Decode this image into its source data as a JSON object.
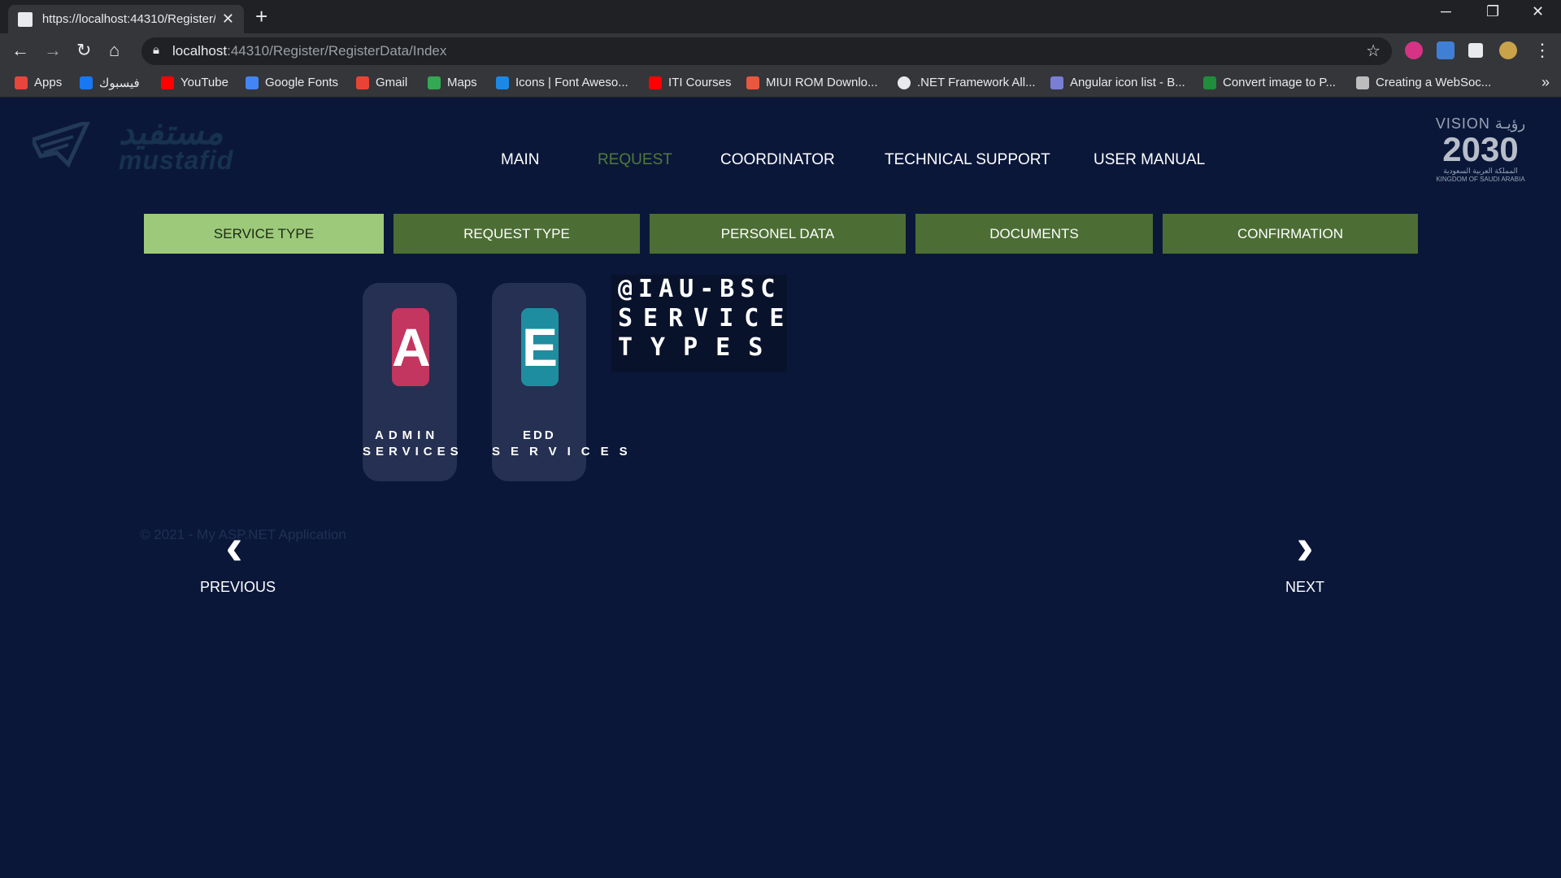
{
  "browser": {
    "tab_title": "https://localhost:44310/Register/",
    "tab_close": "✕",
    "new_tab": "+",
    "window_controls": [
      "─",
      "❐",
      "✕"
    ],
    "url_host": "localhost",
    "url_path": ":44310/Register/RegisterData/Index",
    "bookmarks": [
      {
        "label": "Apps",
        "color": "#e8453c"
      },
      {
        "label": "فيسبوك",
        "color": "#1877f2"
      },
      {
        "label": "YouTube",
        "color": "#ff0000"
      },
      {
        "label": "Google Fonts",
        "color": "#4285f4"
      },
      {
        "label": "Gmail",
        "color": "#ea4335"
      },
      {
        "label": "Maps",
        "color": "#34a853"
      },
      {
        "label": "Icons | Font Aweso...",
        "color": "#1c88e5"
      },
      {
        "label": "ITI Courses",
        "color": "#ff0000"
      },
      {
        "label": "MIUI ROM Downlo...",
        "color": "#e9573f"
      },
      {
        "label": ".NET Framework All...",
        "color": "#e8eaed"
      },
      {
        "label": "Angular icon list - B...",
        "color": "#7a7fd6"
      },
      {
        "label": "Convert image to P...",
        "color": "#1f8d3a"
      },
      {
        "label": "Creating a WebSoc...",
        "color": "#bdbdbd"
      }
    ],
    "bookmarks_more": "»"
  },
  "header": {
    "logo_arabic": "مستفيد",
    "logo_latin": "mustafid",
    "nav": [
      {
        "label": "MAIN",
        "active": false
      },
      {
        "label": "REQUEST",
        "active": true
      },
      {
        "label": "COORDINATOR",
        "active": false
      },
      {
        "label": "TECHNICAL SUPPORT",
        "active": false
      },
      {
        "label": "USER MANUAL",
        "active": false
      }
    ],
    "vision": {
      "line1": "VISION رؤيـة",
      "year": "2030",
      "arabic": "المملكة العربية السعودية",
      "english": "KINGDOM OF SAUDI ARABIA"
    }
  },
  "steps": [
    {
      "label": "SERVICE TYPE",
      "active": true
    },
    {
      "label": "REQUEST TYPE",
      "active": false
    },
    {
      "label": "PERSONEL DATA",
      "active": false
    },
    {
      "label": "DOCUMENTS",
      "active": false
    },
    {
      "label": "CONFIRMATION",
      "active": false
    }
  ],
  "services": [
    {
      "letter": "A",
      "color": "#c2365f",
      "line1": "ADMIN",
      "line2": "SERVICES"
    },
    {
      "letter": "E",
      "color": "#1f8da0",
      "line1": "EDD",
      "line2": "SERVICES"
    }
  ],
  "brand": {
    "line1": "@IAU-BSC",
    "line2": "SERVICE",
    "line3": "TYPES"
  },
  "footer": {
    "copyright": "© 2021 - My ASP.NET Application"
  },
  "pager": {
    "previous_icon": "‹",
    "previous_label": "PREVIOUS",
    "next_icon": "›",
    "next_label": "NEXT"
  }
}
